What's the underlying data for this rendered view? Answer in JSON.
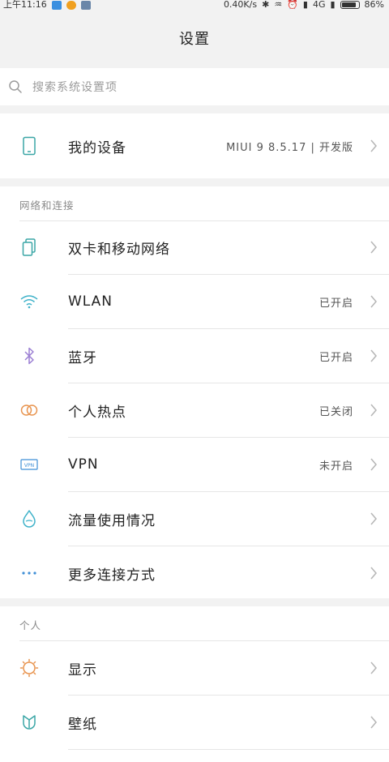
{
  "status_bar": {
    "time": "上午11:16",
    "network_speed": "0.40K/s",
    "network_type": "4G",
    "battery": "86%"
  },
  "title": "设置",
  "search": {
    "placeholder": "搜索系统设置项"
  },
  "device": {
    "label": "我的设备",
    "value": "MIUI 9 8.5.17 | 开发版"
  },
  "sections": {
    "network": {
      "header": "网络和连接",
      "items": [
        {
          "label": "双卡和移动网络",
          "value": "",
          "icon": "dual-sim-icon"
        },
        {
          "label": "WLAN",
          "value": "已开启",
          "icon": "wifi-icon"
        },
        {
          "label": "蓝牙",
          "value": "已开启",
          "icon": "bluetooth-icon"
        },
        {
          "label": "个人热点",
          "value": "已关闭",
          "icon": "hotspot-icon"
        },
        {
          "label": "VPN",
          "value": "未开启",
          "icon": "vpn-icon"
        },
        {
          "label": "流量使用情况",
          "value": "",
          "icon": "data-usage-icon"
        },
        {
          "label": "更多连接方式",
          "value": "",
          "icon": "more-icon"
        }
      ]
    },
    "personal": {
      "header": "个人",
      "items": [
        {
          "label": "显示",
          "value": "",
          "icon": "display-icon"
        },
        {
          "label": "壁纸",
          "value": "",
          "icon": "wallpaper-icon"
        }
      ]
    }
  },
  "colors": {
    "background": "#f2f2f2",
    "teal": "#3aa6a6",
    "blue": "#3f8fd6",
    "purple": "#9b7fd3",
    "orange": "#e8944f",
    "cyan": "#3fb2c9"
  }
}
